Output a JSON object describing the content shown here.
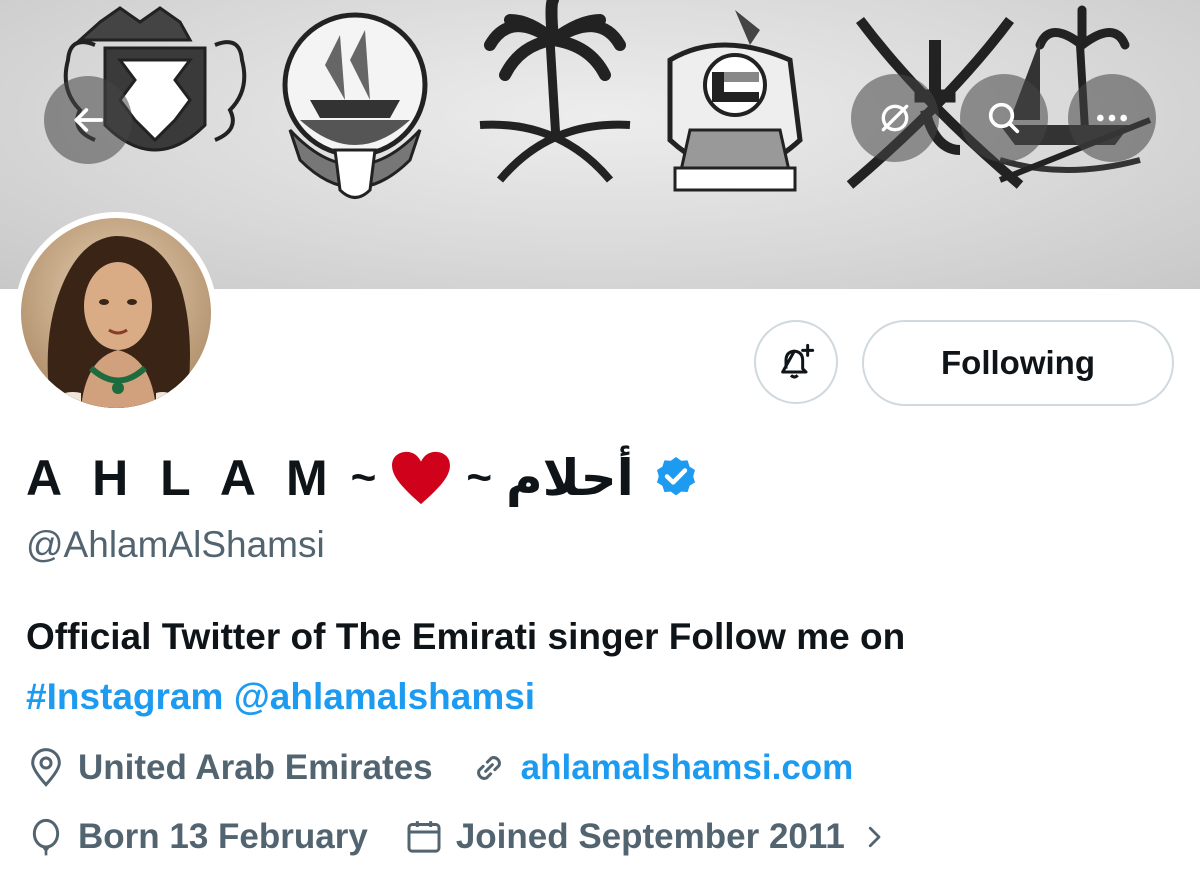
{
  "profile": {
    "name_latin": "A H L A M",
    "name_sep": "~",
    "name_arabic": "أحلام",
    "handle": "@AhlamAlShamsi",
    "bio_line1": "Official Twitter of The Emirati singer Follow me on",
    "bio_hashtag": "#Instagram",
    "bio_mention": "@ahlamalshamsi",
    "location": "United Arab Emirates",
    "website": "ahlamalshamsi.com",
    "birthday": "Born 13 February",
    "joined": "Joined September 2011"
  },
  "actions": {
    "follow_label": "Following"
  },
  "icons": [
    "back-arrow-icon",
    "no-preview-icon",
    "search-icon",
    "more-icon",
    "bell-plus-icon",
    "verified-badge-icon",
    "location-pin-icon",
    "link-icon",
    "balloon-icon",
    "calendar-icon",
    "chevron-right-icon"
  ],
  "colors": {
    "accent": "#1d9bf0",
    "secondary_text": "#536471",
    "primary_text": "#0f1419",
    "border": "#cfd9de",
    "heart": "#d0021b"
  }
}
